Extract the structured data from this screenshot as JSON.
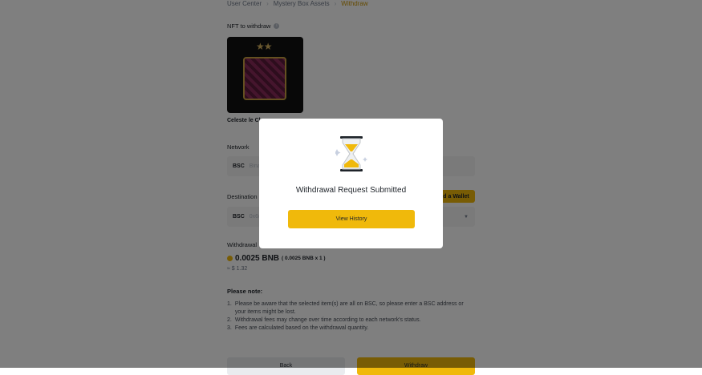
{
  "breadcrumb": {
    "items": [
      "User Center",
      "Mystery Box Assets",
      "Withdraw"
    ],
    "separator": "›"
  },
  "nft_section": {
    "title": "NFT to withdraw",
    "stars": "★★",
    "name": "Celeste le Cl"
  },
  "network": {
    "label": "Network",
    "value": "BSC",
    "hint": "Bina"
  },
  "destination": {
    "label": "Destination",
    "network": "BSC",
    "address_prefix": "0x6r",
    "add_wallet_label": "d a Wallet"
  },
  "fee": {
    "label": "Withdrawal",
    "amount": "0.0025 BNB",
    "detail": "( 0.0025 BNB x 1 )",
    "usd": "≈ $ 1.32"
  },
  "notes": {
    "title": "Please note:",
    "items": [
      {
        "num": "1.",
        "text": "Please be aware that the selected item(s) are all on BSC, so please enter a BSC address or your items might be lost."
      },
      {
        "num": "2.",
        "text": "Withdrawal fees may change over time according to each network's status."
      },
      {
        "num": "3.",
        "text": "Fees are calculated based on the withdrawal quantity."
      }
    ]
  },
  "buttons": {
    "back": "Back",
    "withdraw": "Withdraw"
  },
  "modal": {
    "title": "Withdrawal Request Submitted",
    "button": "View History",
    "icon": "hourglass-icon"
  },
  "colors": {
    "accent": "#f0b90b",
    "overlay": "rgba(0,0,0,0.5)"
  }
}
